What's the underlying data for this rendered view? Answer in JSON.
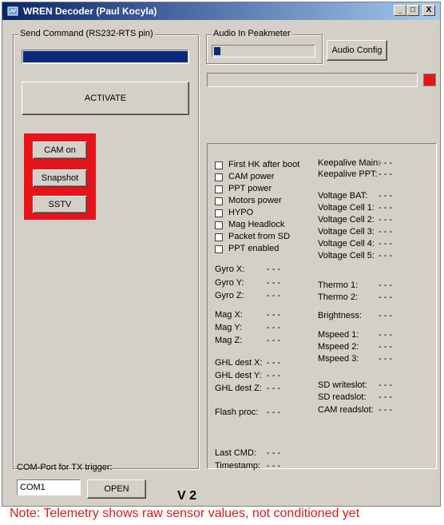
{
  "window": {
    "title": "WREN Decoder (Paul Kocyla)",
    "min_glyph": "_",
    "max_glyph": "□",
    "close_glyph": "X"
  },
  "send_command": {
    "group_label": "Send Command (RS232-RTS pin)",
    "activate_label": "ACTIVATE"
  },
  "audio": {
    "group_label": "Audio In Peakmeter",
    "config_label": "Audio Config",
    "peak_level": 0.06
  },
  "indicator_color": "#e8141c",
  "camera_buttons": {
    "cam_on": "CAM on",
    "snapshot": "Snapshot",
    "sstv": "SSTV"
  },
  "status_flags": [
    "First HK after boot",
    "CAM power",
    "PPT power",
    "Motors power",
    "HYPO",
    "Mag Headlock",
    "Packet from SD",
    "PPT enabled"
  ],
  "right_telemetry": [
    {
      "label": "Keepalive Main:",
      "value": "- - -"
    },
    {
      "label": "Keepalive PPT:",
      "value": "- - -"
    },
    {
      "label": "Voltage BAT:",
      "value": "- - -"
    },
    {
      "label": "Voltage Cell 1:",
      "value": "- - -"
    },
    {
      "label": "Voltage Cell 2:",
      "value": "- - -"
    },
    {
      "label": "Voltage Cell 3:",
      "value": "- - -"
    },
    {
      "label": "Voltage Cell 4:",
      "value": "- - -"
    },
    {
      "label": "Voltage Cell 5:",
      "value": "- - -"
    },
    {
      "label": "Thermo 1:",
      "value": "- - -"
    },
    {
      "label": "Thermo 2:",
      "value": "- - -"
    },
    {
      "label": "Brightness:",
      "value": "- - -"
    },
    {
      "label": "Mspeed 1:",
      "value": "- - -"
    },
    {
      "label": "Mspeed 2:",
      "value": "- - -"
    },
    {
      "label": "Mspeed 3:",
      "value": "- - -"
    },
    {
      "label": "SD writeslot:",
      "value": "- - -"
    },
    {
      "label": "SD readslot:",
      "value": "- - -"
    },
    {
      "label": "CAM readslot:",
      "value": "- - -"
    }
  ],
  "left_telemetry": [
    {
      "label": "Gyro X:",
      "value": "- - -"
    },
    {
      "label": "Gyro Y:",
      "value": "- - -"
    },
    {
      "label": "Gyro Z:",
      "value": "- - -"
    },
    {
      "label": "Mag X:",
      "value": "- - -"
    },
    {
      "label": "Mag Y:",
      "value": "- - -"
    },
    {
      "label": "Mag Z:",
      "value": "- - -"
    },
    {
      "label": "GHL dest X:",
      "value": "- - -"
    },
    {
      "label": "GHL dest Y:",
      "value": "- - -"
    },
    {
      "label": "GHL dest Z:",
      "value": "- - -"
    },
    {
      "label": "Flash proc:",
      "value": "- - -"
    },
    {
      "label": "Last CMD:",
      "value": "- - -"
    },
    {
      "label": "Timestamp:",
      "value": "- - -"
    }
  ],
  "com_port": {
    "label": "COM-Port for TX trigger:",
    "value": "COM1",
    "open_label": "OPEN"
  },
  "version": "V 2",
  "note": "Note: Telemetry shows raw sensor values, not conditioned yet"
}
